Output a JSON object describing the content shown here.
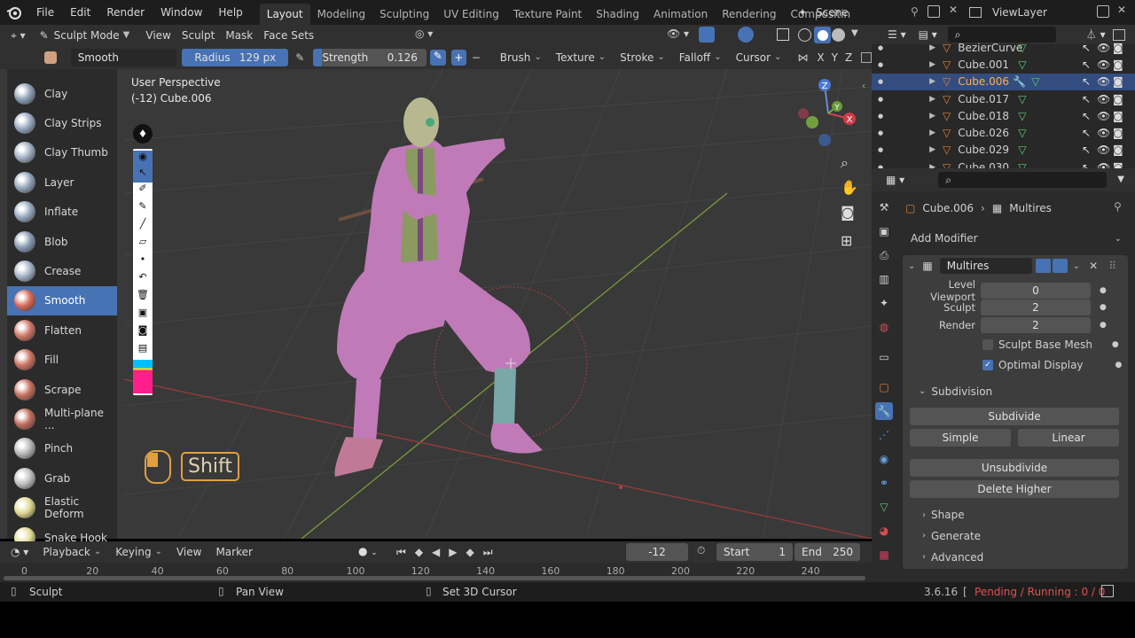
{
  "menu": [
    "File",
    "Edit",
    "Render",
    "Window",
    "Help"
  ],
  "workspaces": [
    {
      "label": "Layout",
      "active": true
    },
    {
      "label": "Modeling",
      "active": false
    },
    {
      "label": "Sculpting",
      "active": false
    },
    {
      "label": "UV Editing",
      "active": false
    },
    {
      "label": "Texture Paint",
      "active": false
    },
    {
      "label": "Shading",
      "active": false
    },
    {
      "label": "Animation",
      "active": false
    },
    {
      "label": "Rendering",
      "active": false
    },
    {
      "label": "Compositin",
      "active": false
    }
  ],
  "scene": "Scene",
  "view_layer": "ViewLayer",
  "header": {
    "mode": "Sculpt Mode",
    "menus": [
      "View",
      "Sculpt",
      "Mask",
      "Face Sets"
    ]
  },
  "toolsettings": {
    "brush_name": "Smooth",
    "radius_label": "Radius",
    "radius_value": "129 px",
    "strength_label": "Strength",
    "strength_value": "0.126",
    "menus": [
      "Brush",
      "Texture",
      "Stroke",
      "Falloff",
      "Cursor"
    ],
    "axes": [
      "X",
      "Y",
      "Z"
    ]
  },
  "viewport": {
    "perspective": "User Perspective",
    "object_info": "(-12) Cube.006",
    "key_hint": "Shift"
  },
  "brushes": [
    {
      "label": "Clay",
      "color": "#8ea0b8",
      "active": false
    },
    {
      "label": "Clay Strips",
      "color": "#9aaac0",
      "active": false
    },
    {
      "label": "Clay Thumb",
      "color": "#a0b0c4",
      "active": false
    },
    {
      "label": "Layer",
      "color": "#94a6bc",
      "active": false
    },
    {
      "label": "Inflate",
      "color": "#98aac0",
      "active": false
    },
    {
      "label": "Blob",
      "color": "#8a9cb4",
      "active": false
    },
    {
      "label": "Crease",
      "color": "#a4b4c8",
      "active": false
    },
    {
      "label": "Smooth",
      "color": "#d86a5a",
      "active": true
    },
    {
      "label": "Flatten",
      "color": "#d07866",
      "active": false
    },
    {
      "label": "Fill",
      "color": "#cc7462",
      "active": false
    },
    {
      "label": "Scrape",
      "color": "#c8705e",
      "active": false
    },
    {
      "label": "Multi-plane ...",
      "color": "#c06c5c",
      "active": false
    },
    {
      "label": "Pinch",
      "color": "#b8b8b8",
      "active": false
    },
    {
      "label": "Grab",
      "color": "#c0c0c0",
      "active": false
    },
    {
      "label": "Elastic Deform",
      "color": "#e0d890",
      "active": false
    },
    {
      "label": "Snake Hook",
      "color": "#e4dc94",
      "active": false
    }
  ],
  "timeline": {
    "menus": [
      "Playback",
      "Keying",
      "View",
      "Marker"
    ],
    "current_frame": "-12",
    "start_label": "Start",
    "start": "1",
    "end_label": "End",
    "end": "250",
    "ticks": [
      "0",
      "20",
      "40",
      "60",
      "80",
      "100",
      "120",
      "140",
      "160",
      "180",
      "200",
      "220",
      "240"
    ]
  },
  "status": {
    "left": "Sculpt",
    "middle": "Pan View",
    "right": "Set 3D Cursor",
    "version": "3.6.16",
    "jobs": "Pending / Running : 0 / 0"
  },
  "outliner": {
    "items": [
      {
        "label": "BezierCurve",
        "active": false,
        "partial": true
      },
      {
        "label": "Cube.001",
        "active": false
      },
      {
        "label": "Cube.006",
        "active": true
      },
      {
        "label": "Cube.017",
        "active": false
      },
      {
        "label": "Cube.018",
        "active": false
      },
      {
        "label": "Cube.026",
        "active": false
      },
      {
        "label": "Cube.029",
        "active": false
      },
      {
        "label": "Cube.030",
        "active": false,
        "partial": true
      }
    ]
  },
  "properties": {
    "object": "Cube.006",
    "modifier_breadcrumb": "Multires",
    "add_modifier": "Add Modifier",
    "modifier_name": "Multires",
    "level_viewport_label": "Level Viewport",
    "level_viewport": "0",
    "sculpt_label": "Sculpt",
    "sculpt": "2",
    "render_label": "Render",
    "render": "2",
    "sculpt_base_mesh": "Sculpt Base Mesh",
    "optimal_display": "Optimal Display",
    "subdivision": "Subdivision",
    "subdivide": "Subdivide",
    "simple": "Simple",
    "linear": "Linear",
    "unsubdivide": "Unsubdivide",
    "delete_higher": "Delete Higher",
    "shape": "Shape",
    "generate": "Generate",
    "advanced": "Advanced"
  },
  "colors": {
    "accent": "#4772b3",
    "active_row": "#334d80",
    "mesh_color": "#f0a030",
    "status_warning": "#e05050"
  }
}
